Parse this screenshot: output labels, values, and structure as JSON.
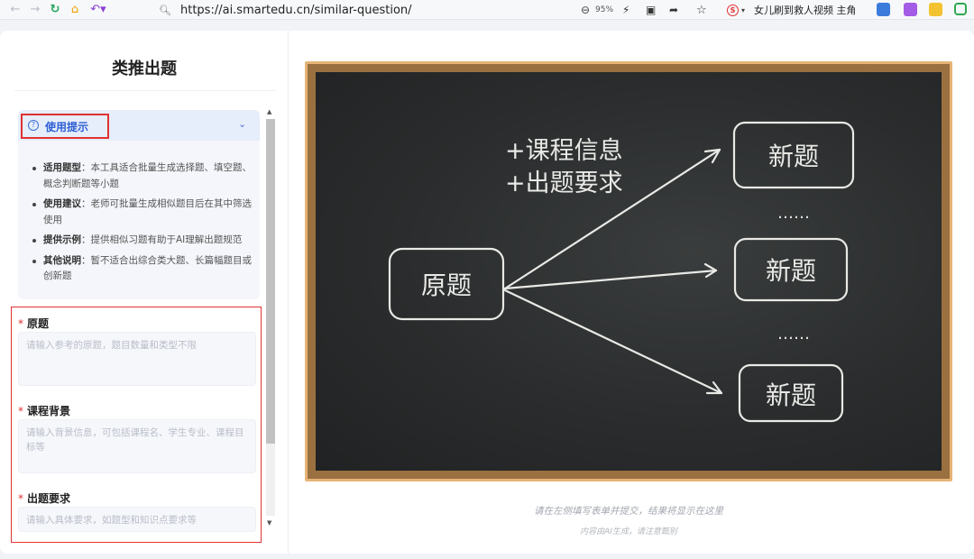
{
  "browser": {
    "url": "https://ai.smartedu.cn/similar-question/",
    "zoom": "95%",
    "news_text": "女儿刷到救人视频 主角"
  },
  "panel": {
    "title": "类推出题",
    "tips": {
      "title": "使用提示",
      "items": [
        {
          "label": "适用题型",
          "text": "：本工具适合批量生成选择题、填空题、概念判断题等小题"
        },
        {
          "label": "使用建议",
          "text": "：老师可批量生成相似题目后在其中筛选使用"
        },
        {
          "label": "提供示例",
          "text": "：提供相似习题有助于AI理解出题规范"
        },
        {
          "label": "其他说明",
          "text": "：暂不适合出综合类大题、长篇幅题目或创新题"
        }
      ]
    },
    "required_mark": "*",
    "fields": [
      {
        "label": "原题",
        "placeholder": "请输入参考的原题，题目数量和类型不限"
      },
      {
        "label": "课程背景",
        "placeholder": "请输入背景信息，可包括课程名、学生专业、课程目标等"
      },
      {
        "label": "出题要求",
        "placeholder": "请输入具体要求，如题型和知识点要求等"
      }
    ]
  },
  "chalkboard": {
    "source_box": "原题",
    "inputs_line1": "+课程信息",
    "inputs_line2": "+出题要求",
    "output_boxes": [
      "新题",
      "新题",
      "新题"
    ],
    "ellipsis": "……"
  },
  "output": {
    "hint": "请在左侧填写表单并提交，结果将显示在这里",
    "disclaimer": "内容由AI生成，请注意甄别"
  },
  "colors": {
    "accent": "#2c5fd3",
    "highlight": "#e03131",
    "frame": "#e6b476",
    "board": "#2b2d2e",
    "chalk": "#e9e9e6"
  }
}
